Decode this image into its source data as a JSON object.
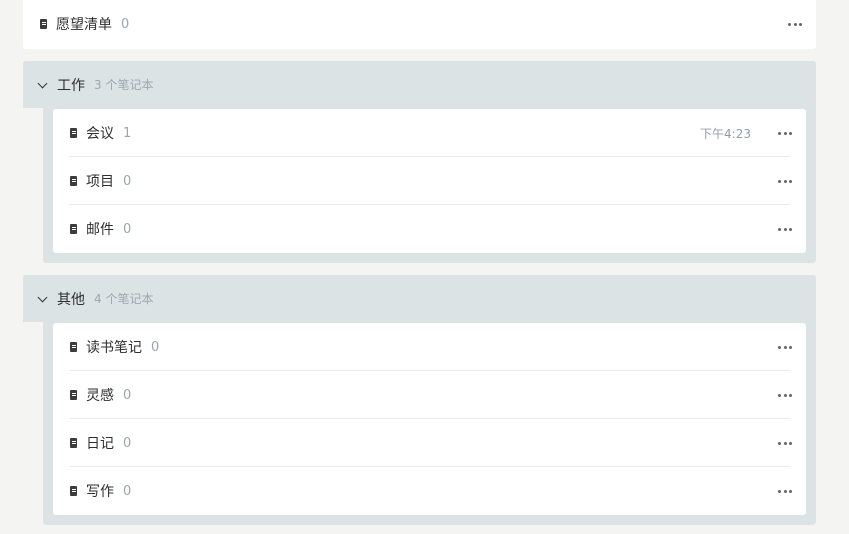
{
  "top_notebook": {
    "name": "愿望清单",
    "count": "0"
  },
  "stacks": [
    {
      "title": "工作",
      "subtitle": "3 个笔记本",
      "notebooks": [
        {
          "name": "会议",
          "count": "1",
          "time": "下午4:23"
        },
        {
          "name": "项目",
          "count": "0"
        },
        {
          "name": "邮件",
          "count": "0"
        }
      ]
    },
    {
      "title": "其他",
      "subtitle": "4 个笔记本",
      "notebooks": [
        {
          "name": "读书笔记",
          "count": "0"
        },
        {
          "name": "灵感",
          "count": "0"
        },
        {
          "name": "日记",
          "count": "0"
        },
        {
          "name": "写作",
          "count": "0"
        }
      ]
    }
  ],
  "icons": {
    "notebook": "notebook-icon",
    "more": "more-options-icon",
    "chevron": "chevron-down-icon"
  },
  "colors": {
    "stack_background": "#dbe3e5",
    "count_text": "#9aa6ae",
    "card_background": "#ffffff"
  }
}
